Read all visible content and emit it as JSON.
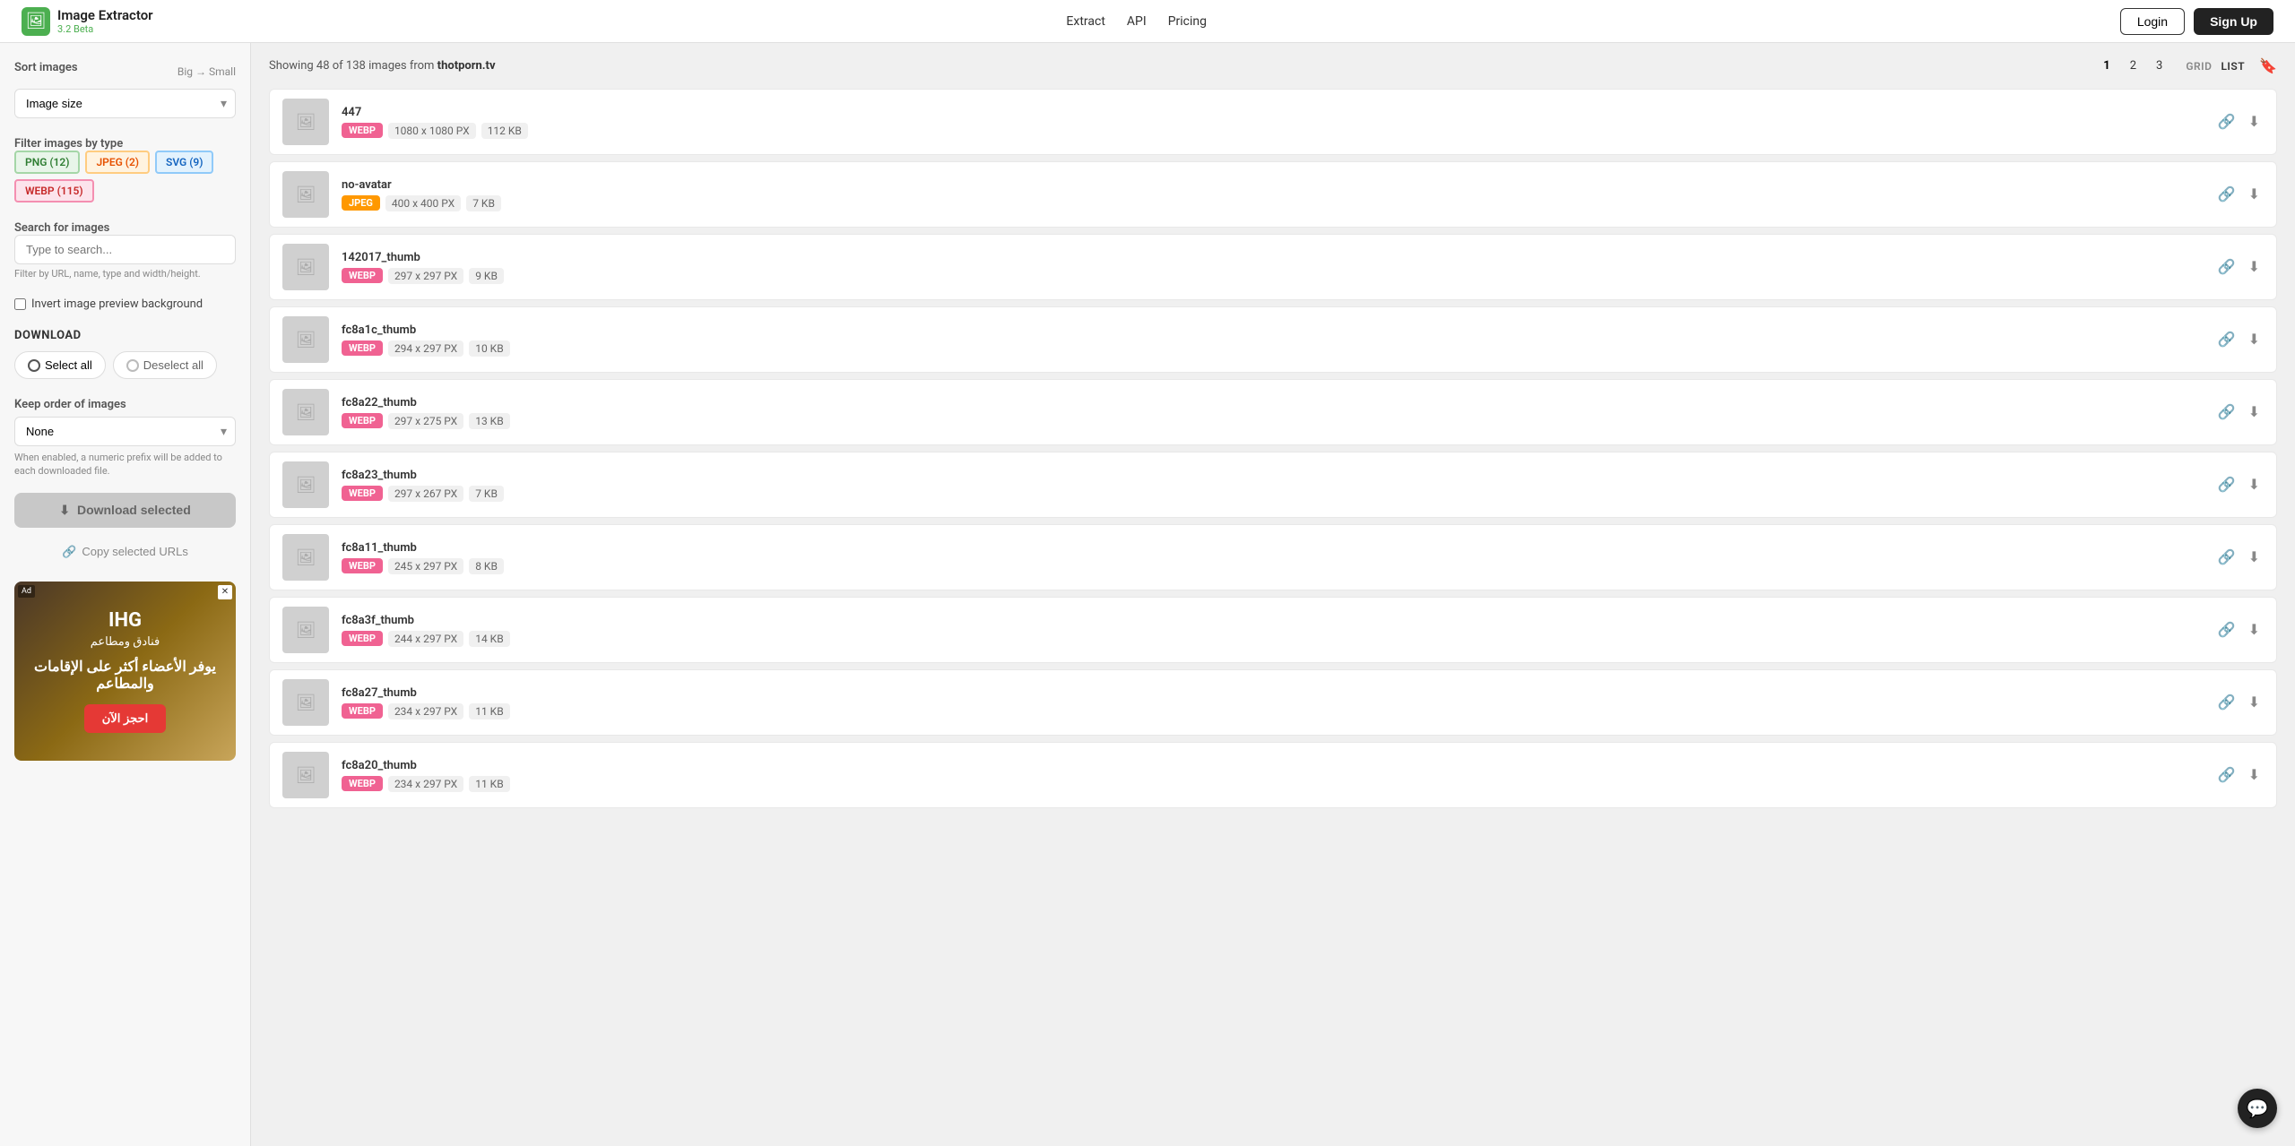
{
  "header": {
    "logo_icon": "🖼",
    "logo_name": "Image Extractor",
    "logo_beta": "3.2 Beta",
    "nav": [
      {
        "label": "Extract",
        "href": "#"
      },
      {
        "label": "API",
        "href": "#"
      },
      {
        "label": "Pricing",
        "href": "#"
      }
    ],
    "login_label": "Login",
    "signup_label": "Sign Up"
  },
  "sidebar": {
    "sort_label": "Sort images",
    "sort_direction": "Big → Small",
    "sort_value": "Image size",
    "filter_label": "Filter images by type",
    "chips": [
      {
        "label": "PNG (12)",
        "type": "png"
      },
      {
        "label": "JPEG (2)",
        "type": "jpeg"
      },
      {
        "label": "SVG (9)",
        "type": "svg"
      },
      {
        "label": "WEBP (115)",
        "type": "webp"
      }
    ],
    "search_label": "Search for images",
    "search_placeholder": "Type to search...",
    "search_hint": "Filter by URL, name, type and width/height.",
    "invert_label": "Invert image preview background",
    "download_title": "DOWNLOAD",
    "select_all_label": "Select all",
    "deselect_all_label": "Deselect all",
    "keep_order_label": "Keep order of images",
    "keep_order_value": "None",
    "keep_order_hint": "When enabled, a numeric prefix will be added to each downloaded file.",
    "download_btn": "Download selected",
    "copy_urls_btn": "Copy selected URLs"
  },
  "ad": {
    "title": "IHG",
    "subtitle": "فنادق ومطاعم",
    "body": "يوفر الأعضاء أكثر على الإقامات والمطاعم",
    "cta": "احجز الآن",
    "x_label": "×"
  },
  "main": {
    "showing_text": "Showing 48 of 138 images from",
    "domain": "thotporn.tv",
    "pages": [
      {
        "num": "1",
        "active": true
      },
      {
        "num": "2",
        "active": false
      },
      {
        "num": "3",
        "active": false
      }
    ],
    "view_grid": "GRID",
    "view_list": "LIST",
    "images": [
      {
        "name": "447",
        "type": "webp",
        "badge_class": "badge-webp",
        "dimensions": "1080 x 1080 PX",
        "filesize": "112 KB",
        "has_thumb": false
      },
      {
        "name": "no-avatar",
        "type": "jpeg",
        "badge_class": "badge-jpeg",
        "dimensions": "400 x 400 PX",
        "filesize": "7 KB",
        "has_thumb": false
      },
      {
        "name": "142017_thumb",
        "type": "webp",
        "badge_class": "badge-webp",
        "dimensions": "297 x 297 PX",
        "filesize": "9 KB",
        "has_thumb": false
      },
      {
        "name": "fc8a1c_thumb",
        "type": "webp",
        "badge_class": "badge-webp",
        "dimensions": "294 x 297 PX",
        "filesize": "10 KB",
        "has_thumb": false
      },
      {
        "name": "fc8a22_thumb",
        "type": "webp",
        "badge_class": "badge-webp",
        "dimensions": "297 x 275 PX",
        "filesize": "13 KB",
        "has_thumb": false
      },
      {
        "name": "fc8a23_thumb",
        "type": "webp",
        "badge_class": "badge-webp",
        "dimensions": "297 x 267 PX",
        "filesize": "7 KB",
        "has_thumb": false
      },
      {
        "name": "fc8a11_thumb",
        "type": "webp",
        "badge_class": "badge-webp",
        "dimensions": "245 x 297 PX",
        "filesize": "8 KB",
        "has_thumb": false
      },
      {
        "name": "fc8a3f_thumb",
        "type": "webp",
        "badge_class": "badge-webp",
        "dimensions": "244 x 297 PX",
        "filesize": "14 KB",
        "has_thumb": false
      },
      {
        "name": "fc8a27_thumb",
        "type": "webp",
        "badge_class": "badge-webp",
        "dimensions": "234 x 297 PX",
        "filesize": "11 KB",
        "has_thumb": false
      },
      {
        "name": "fc8a20_thumb",
        "type": "webp",
        "badge_class": "badge-webp",
        "dimensions": "234 x 297 PX",
        "filesize": "11 KB",
        "has_thumb": false
      }
    ]
  },
  "chat_widget": {
    "icon": "💬"
  }
}
